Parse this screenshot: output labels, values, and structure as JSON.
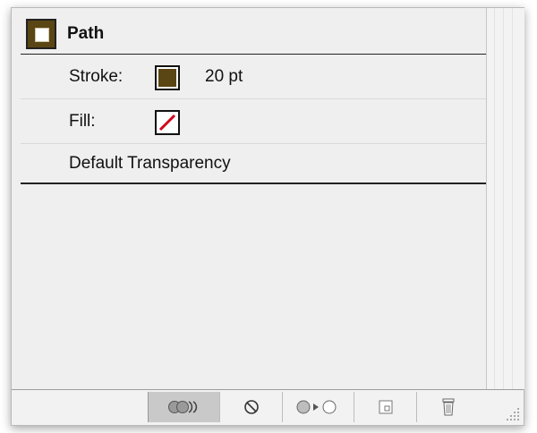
{
  "panel": {
    "header": {
      "title": "Path"
    },
    "rows": {
      "stroke": {
        "label": "Stroke:",
        "value": "20 pt",
        "color": "#5a4514"
      },
      "fill": {
        "label": "Fill:"
      },
      "transparency": {
        "label": "Default Transparency"
      }
    }
  },
  "toolbar": {
    "buttons": [
      "visibility-toggle-icon",
      "clear-appearance-icon",
      "reduce-to-basic-icon",
      "duplicate-item-icon",
      "trash-icon"
    ]
  }
}
